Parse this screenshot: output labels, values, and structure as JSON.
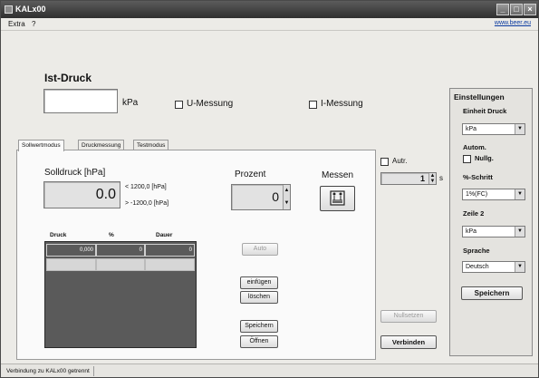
{
  "window": {
    "title": "KALx00",
    "minimize_glyph": "_",
    "maximize_glyph": "□",
    "close_glyph": "×"
  },
  "menu": {
    "extra": "Extra",
    "help": "?",
    "website": "www.beer.eu"
  },
  "ist_druck": {
    "label": "Ist-Druck",
    "value": "",
    "unit": "kPa"
  },
  "options": {
    "u_messung": "U-Messung",
    "i_messung": "I-Messung"
  },
  "tabs": [
    "Sollwertmodus",
    "Druckmessung",
    "Testmodus"
  ],
  "solldruck": {
    "label": "Solldruck [hPa]",
    "value": "0.0",
    "limit_max": "< 1200,0 [hPa]",
    "limit_min": "> -1200,0 [hPa]"
  },
  "prozent": {
    "label": "Prozent",
    "value": "0"
  },
  "messen": {
    "label": "Messen",
    "icon": "measure-device-icon"
  },
  "auto_repeat": {
    "label": "Autr.",
    "value": "1",
    "unit": "s"
  },
  "table": {
    "headers": [
      "Druck",
      "%",
      "Dauer"
    ],
    "rows": [
      [
        "0,000",
        "0",
        "0"
      ]
    ]
  },
  "buttons": {
    "auto": "Auto",
    "einfuegen": "einfügen",
    "loeschen": "löschen",
    "speichern": "Speichern",
    "oeffnen": "Öffnen",
    "nullsetzen": "Nullsetzen",
    "verbinden": "Verbinden"
  },
  "settings": {
    "title": "Einstellungen",
    "einheit_label": "Einheit Druck",
    "einheit_value": "kPa",
    "autom_label": "Autom.",
    "nullg_label": "Nullg.",
    "schritt_label": "%-Schritt",
    "schritt_value": "1%(FC)",
    "zeile2_label": "Zeile 2",
    "zeile2_value": "kPa",
    "sprache_label": "Sprache",
    "sprache_value": "Deutsch",
    "save_button": "Speichern"
  },
  "status": {
    "text": "Verbindung zu KALx00 getrennt"
  }
}
